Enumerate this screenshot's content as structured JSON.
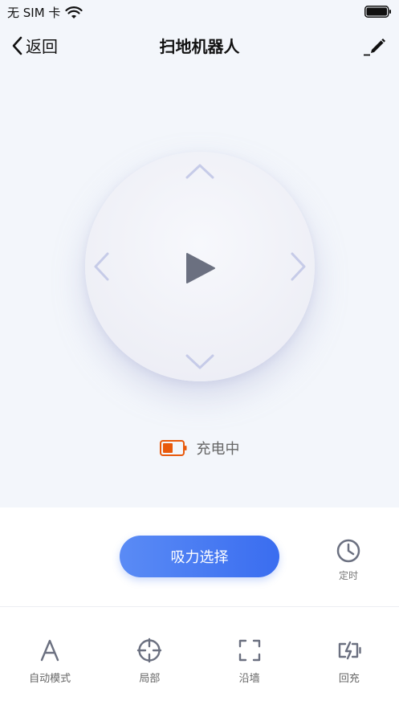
{
  "status_bar": {
    "carrier": "无 SIM 卡"
  },
  "nav": {
    "back_label": "返回",
    "title": "扫地机器人"
  },
  "device": {
    "charge_status": "充电中",
    "battery_color": "#e8590c"
  },
  "actions": {
    "suction_label": "吸力选择",
    "timer_label": "定时"
  },
  "modes": [
    {
      "label": "自动模式",
      "icon": "letter-a-icon"
    },
    {
      "label": "局部",
      "icon": "crosshair-icon"
    },
    {
      "label": "沿墙",
      "icon": "frame-corners-icon"
    },
    {
      "label": "回充",
      "icon": "charging-icon"
    }
  ],
  "colors": {
    "accent": "#3a6df0",
    "icon_gray": "#6b7080",
    "arrow": "#c6cbe8"
  }
}
